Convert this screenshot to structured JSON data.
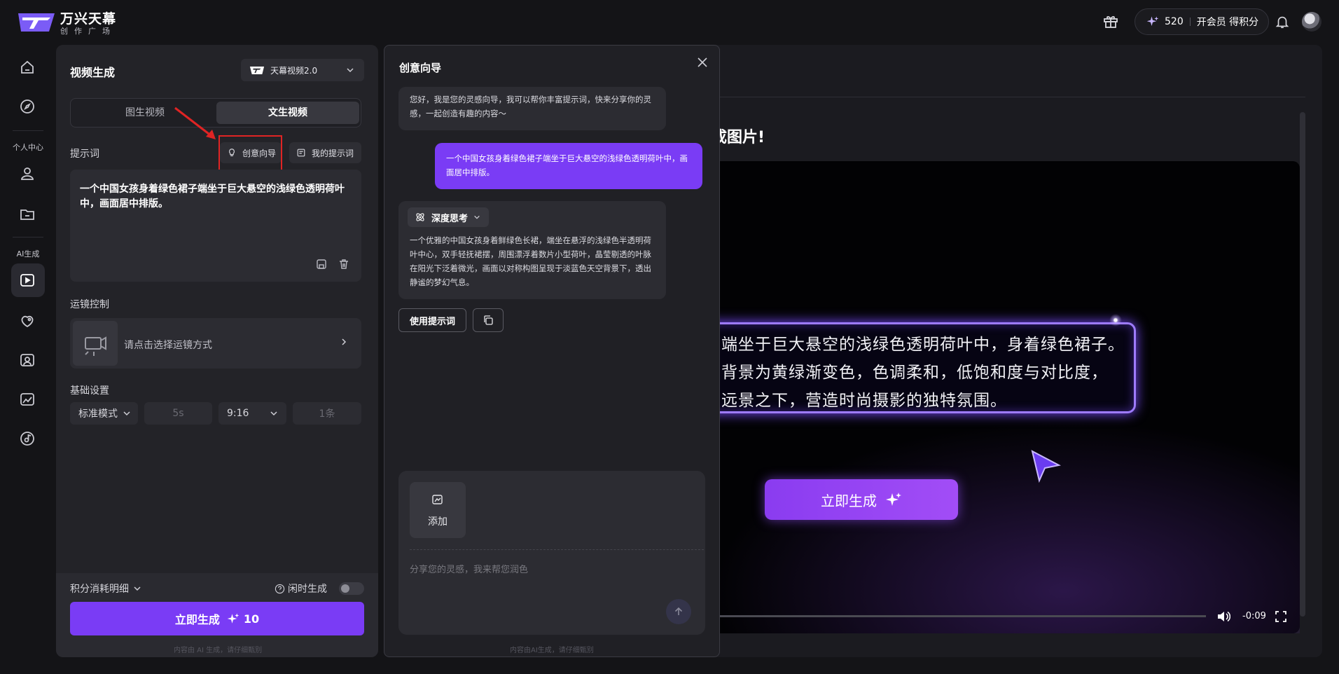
{
  "brand": {
    "title": "万兴天幕",
    "subtitle": "创作广场"
  },
  "topbar": {
    "credits": "520",
    "member_cta": "开会员 得积分",
    "icons": [
      "gift-icon",
      "sparkle-icon",
      "bell-icon",
      "avatar"
    ]
  },
  "sidebar": {
    "section_personal": "个人中心",
    "section_ai": "AI生成",
    "icons": [
      "home-icon",
      "compass-icon",
      "user-icon",
      "folder-icon",
      "video-gen-icon",
      "image-gen-icon",
      "avatar-gen-icon",
      "photo-edit-icon",
      "music-icon"
    ]
  },
  "left_panel": {
    "title": "视频生成",
    "model": "天幕视频2.0",
    "tabs": [
      {
        "label": "图生视频",
        "active": false
      },
      {
        "label": "文生视频",
        "active": true
      }
    ],
    "prompt_label": "提示词",
    "guide_chip": "创意向导",
    "my_prompts_chip": "我的提示词",
    "prompt_text": "一个中国女孩身着绿色裙子端坐于巨大悬空的浅绿色透明荷叶中，画面居中排版。",
    "camera_label": "运镜控制",
    "camera_placeholder": "请点击选择运镜方式",
    "basic_label": "基础设置",
    "settings": {
      "mode": "标准模式",
      "duration": "5s",
      "ratio": "9:16",
      "count": "1条"
    },
    "cost_detail": "积分消耗明细",
    "idle_generate": "闲时生成",
    "generate_label": "立即生成",
    "generate_cost": "10",
    "footer_note": "内容由 AI 生成，请仔细甄别"
  },
  "modal": {
    "title": "创意向导",
    "greeting": "您好，我是您的灵感向导，我可以帮你丰富提示词，快来分享你的灵感，一起创造有趣的内容～",
    "user_message": "一个中国女孩身着绿色裙子端坐于巨大悬空的浅绿色透明荷叶中，画面居中排版。",
    "think_label": "深度思考",
    "expanded_prompt": "一个优雅的中国女孩身着鲜绿色长裙，端坐在悬浮的浅绿色半透明荷叶中心，双手轻抚裙摆，周围漂浮着数片小型荷叶，晶莹剔透的叶脉在阳光下泛着微光，画面以对称构图呈现于淡蓝色天空背景下，透出静谧的梦幻气息。",
    "use_prompt_button": "使用提示词",
    "add_label": "添加",
    "input_placeholder": "分享您的灵感，我来帮您润色",
    "footer_note": "内容由AI生成，请仔细甄别"
  },
  "preview": {
    "heading_partial": "成图片!",
    "neon_lines": [
      "端坐于巨大悬空的浅绿色透明荷叶中，身着绿色裙子。",
      "背景为黄绿渐变色，色调柔和，低饱和度与对比度，",
      "远景之下，营造时尚摄影的独特氛围。"
    ],
    "cta": "立即生成",
    "time": "-0:09"
  },
  "colors": {
    "accent": "#7a3cf5",
    "panel": "#232328",
    "background": "#141417",
    "highlight_box": "#e02424"
  }
}
